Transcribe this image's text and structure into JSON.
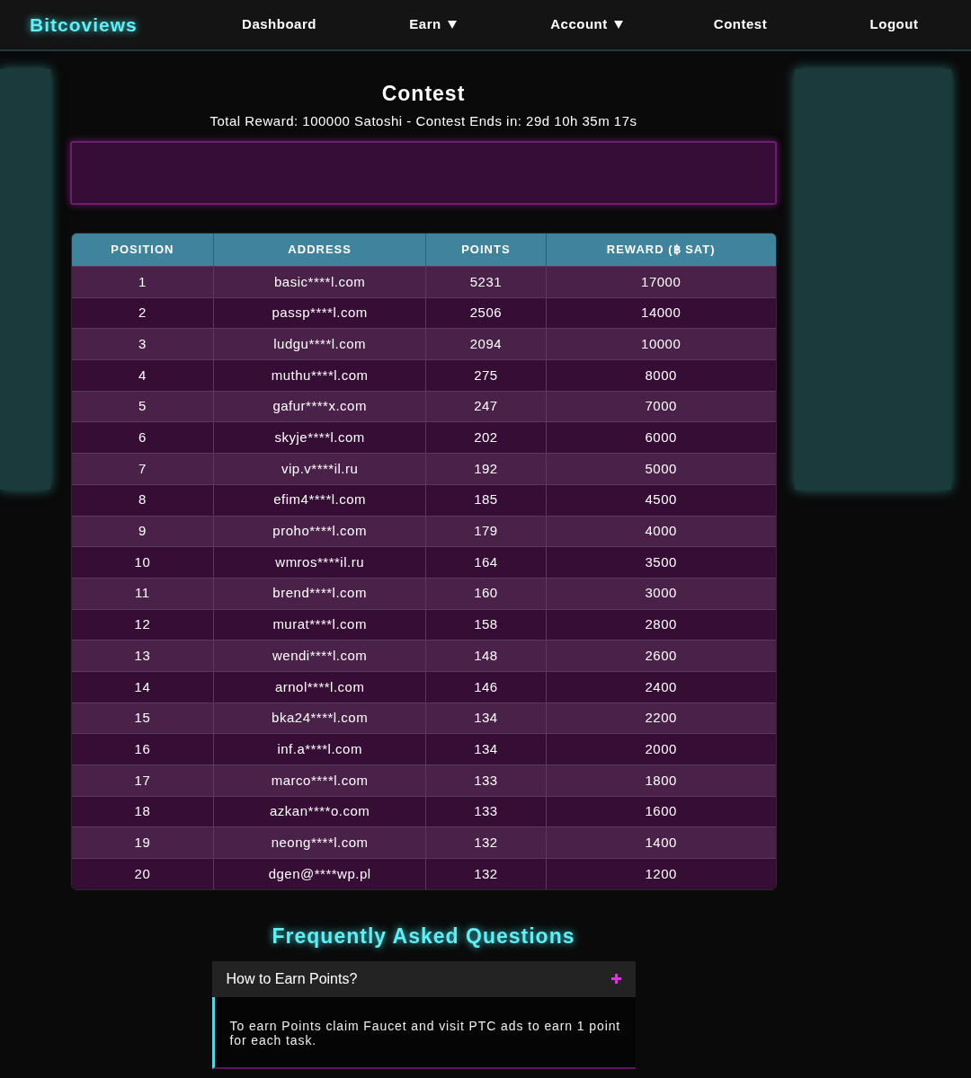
{
  "nav": {
    "logo": "Bitcoviews",
    "items": [
      {
        "label": "Dashboard",
        "has_menu": false
      },
      {
        "label": "Earn",
        "has_menu": true
      },
      {
        "label": "Account",
        "has_menu": true
      },
      {
        "label": "Contest",
        "has_menu": false
      },
      {
        "label": "Logout",
        "has_menu": false
      }
    ]
  },
  "page": {
    "title": "Contest",
    "subtitle": "Total Reward: 100000 Satoshi - Contest Ends in: 29d 10h 35m 17s"
  },
  "table": {
    "columns": [
      "POSITION",
      "ADDRESS",
      "POINTS",
      "REWARD (฿ SAT)"
    ],
    "rows": [
      [
        "1",
        "basic****l.com",
        "5231",
        "17000"
      ],
      [
        "2",
        "passp****l.com",
        "2506",
        "14000"
      ],
      [
        "3",
        "ludgu****l.com",
        "2094",
        "10000"
      ],
      [
        "4",
        "muthu****l.com",
        "275",
        "8000"
      ],
      [
        "5",
        "gafur****x.com",
        "247",
        "7000"
      ],
      [
        "6",
        "skyje****l.com",
        "202",
        "6000"
      ],
      [
        "7",
        "vip.v****il.ru",
        "192",
        "5000"
      ],
      [
        "8",
        "efim4****l.com",
        "185",
        "4500"
      ],
      [
        "9",
        "proho****l.com",
        "179",
        "4000"
      ],
      [
        "10",
        "wmros****il.ru",
        "164",
        "3500"
      ],
      [
        "11",
        "brend****l.com",
        "160",
        "3000"
      ],
      [
        "12",
        "murat****l.com",
        "158",
        "2800"
      ],
      [
        "13",
        "wendi****l.com",
        "148",
        "2600"
      ],
      [
        "14",
        "arnol****l.com",
        "146",
        "2400"
      ],
      [
        "15",
        "bka24****l.com",
        "134",
        "2200"
      ],
      [
        "16",
        "inf.a****l.com",
        "134",
        "2000"
      ],
      [
        "17",
        "marco****l.com",
        "133",
        "1800"
      ],
      [
        "18",
        "azkan****o.com",
        "133",
        "1600"
      ],
      [
        "19",
        "neong****l.com",
        "132",
        "1400"
      ],
      [
        "20",
        "dgen@****wp.pl",
        "132",
        "1200"
      ]
    ]
  },
  "faq": {
    "title": "Frequently Asked Questions",
    "items": [
      {
        "question": "How to Earn Points?",
        "answer": "To earn Points claim Faucet and visit PTC ads to earn 1 point for each task.",
        "expanded": true
      }
    ]
  }
}
